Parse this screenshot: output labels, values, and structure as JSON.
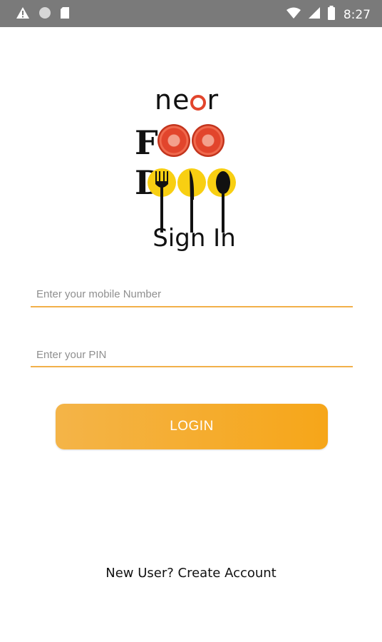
{
  "status_bar": {
    "time": "8:27",
    "left_icons": [
      "warning-icon",
      "circle-icon",
      "sd-card-icon"
    ],
    "right_icons": [
      "wifi-icon",
      "signal-icon",
      "battery-icon"
    ]
  },
  "logo": {
    "near_text_start": "ne",
    "near_text_end": "r",
    "food_text_f": "F",
    "food_text_d": "D"
  },
  "page_title": "Sign In",
  "form": {
    "mobile_placeholder": "Enter your mobile Number",
    "pin_placeholder": "Enter your PIN",
    "login_label": "LOGIN"
  },
  "footer": {
    "create_account": "New User? Create Account"
  },
  "colors": {
    "accent": "#f6a619",
    "underline": "#f2b04a",
    "tomato": "#e2452c",
    "plate_yellow": "#f8cf12"
  }
}
